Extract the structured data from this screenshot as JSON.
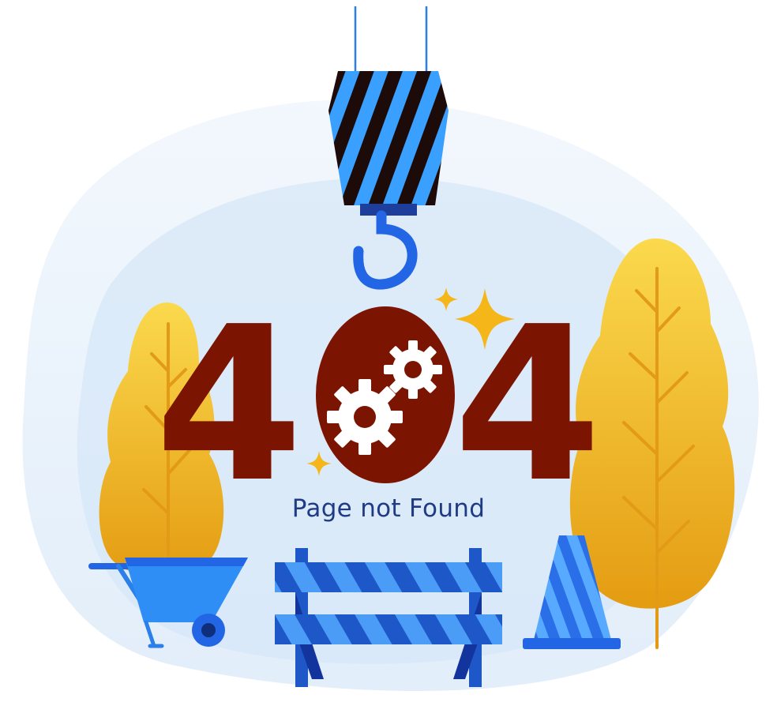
{
  "error": {
    "code_digit_left": "4",
    "code_digit_right": "4",
    "message": "Page not Found"
  },
  "colors": {
    "digits": "#7b1502",
    "hook_blue": "#2266e6",
    "stripe_blue": "#3aa0ff",
    "stripe_dark": "#1d0b09",
    "tree_yellow": "#f2c02a",
    "tree_orange": "#e59b16",
    "backdrop": "#e3eef9",
    "barrier_blue": "#1e57c8",
    "caption": "#1f3b86"
  },
  "icons": [
    "crane-hook-icon",
    "gears-icon",
    "sparkle-icon",
    "tree-icon",
    "wheelbarrow-icon",
    "road-barrier-icon",
    "traffic-cone-icon"
  ]
}
